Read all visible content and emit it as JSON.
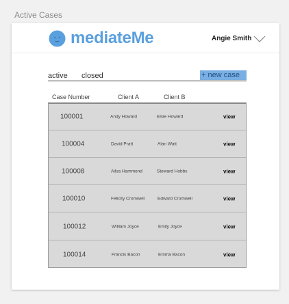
{
  "caption": "Active Cases",
  "header": {
    "brand": "mediateMe",
    "user_name": "Angie Smith"
  },
  "tabs": {
    "active": "active",
    "closed": "closed",
    "new_case": "+ new case"
  },
  "columns": {
    "case_number": "Case Number",
    "client_a": "Client A",
    "client_b": "Client B"
  },
  "rows": [
    {
      "case": "100001",
      "client_a": "Andy Howard",
      "client_b": "Elsie Howard",
      "action": "view"
    },
    {
      "case": "100004",
      "client_a": "David Pratt",
      "client_b": "Alan Watt",
      "action": "view"
    },
    {
      "case": "100008",
      "client_a": "Ailsa Hammond",
      "client_b": "Steward Hobbs",
      "action": "view"
    },
    {
      "case": "100010",
      "client_a": "Felicity Cromwell",
      "client_b": "Edward Cromwell",
      "action": "view"
    },
    {
      "case": "100012",
      "client_a": "William Joyce",
      "client_b": "Emily Joyce",
      "action": "view"
    },
    {
      "case": "100014",
      "client_a": "Francis Bacon",
      "client_b": "Emma Bacon",
      "action": "view"
    }
  ],
  "colors": {
    "brand": "#5aa0de",
    "button": "#7aafe3",
    "table_bg": "#d9d9d9"
  }
}
